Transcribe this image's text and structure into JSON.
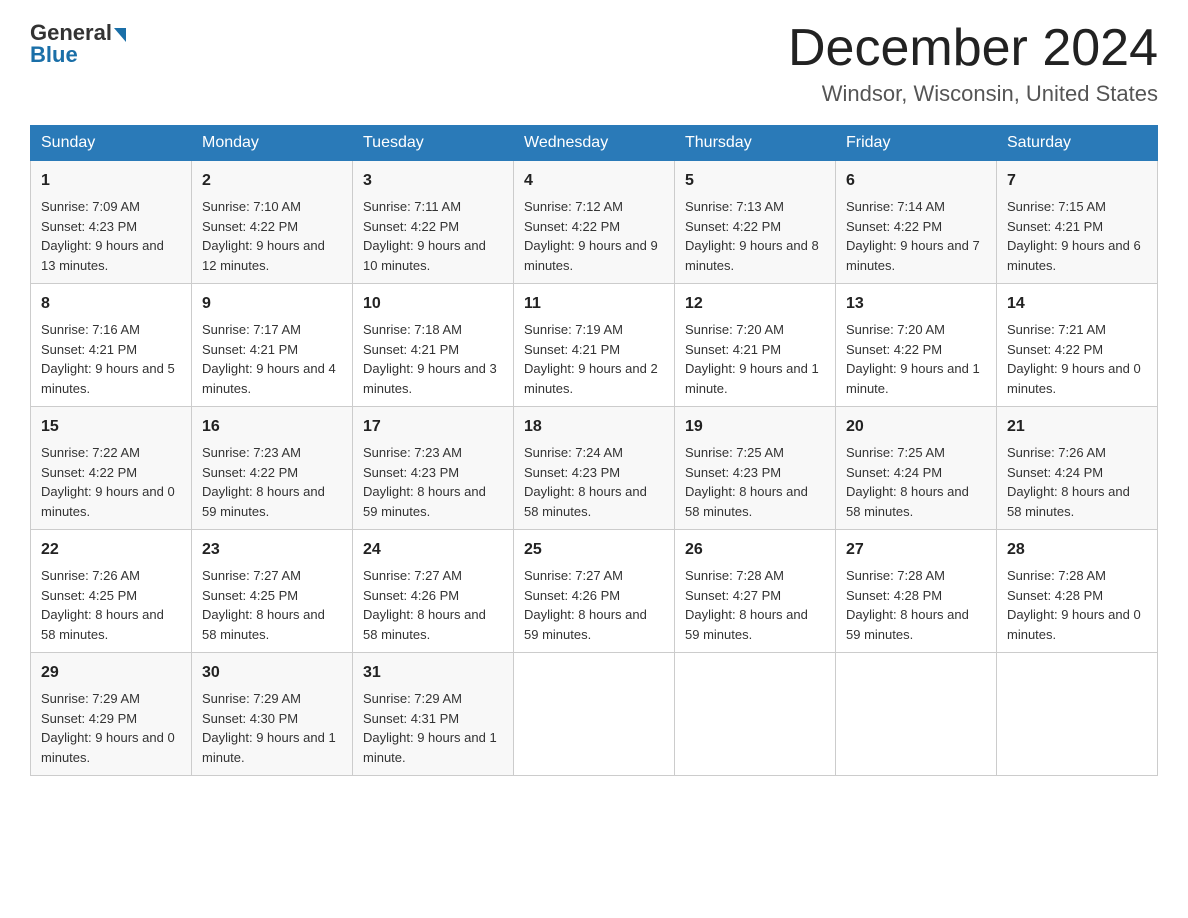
{
  "header": {
    "logo_general": "General",
    "logo_blue": "Blue",
    "month_title": "December 2024",
    "location": "Windsor, Wisconsin, United States"
  },
  "days_of_week": [
    "Sunday",
    "Monday",
    "Tuesday",
    "Wednesday",
    "Thursday",
    "Friday",
    "Saturday"
  ],
  "weeks": [
    [
      {
        "day": "1",
        "sunrise": "7:09 AM",
        "sunset": "4:23 PM",
        "daylight": "9 hours and 13 minutes."
      },
      {
        "day": "2",
        "sunrise": "7:10 AM",
        "sunset": "4:22 PM",
        "daylight": "9 hours and 12 minutes."
      },
      {
        "day": "3",
        "sunrise": "7:11 AM",
        "sunset": "4:22 PM",
        "daylight": "9 hours and 10 minutes."
      },
      {
        "day": "4",
        "sunrise": "7:12 AM",
        "sunset": "4:22 PM",
        "daylight": "9 hours and 9 minutes."
      },
      {
        "day": "5",
        "sunrise": "7:13 AM",
        "sunset": "4:22 PM",
        "daylight": "9 hours and 8 minutes."
      },
      {
        "day": "6",
        "sunrise": "7:14 AM",
        "sunset": "4:22 PM",
        "daylight": "9 hours and 7 minutes."
      },
      {
        "day": "7",
        "sunrise": "7:15 AM",
        "sunset": "4:21 PM",
        "daylight": "9 hours and 6 minutes."
      }
    ],
    [
      {
        "day": "8",
        "sunrise": "7:16 AM",
        "sunset": "4:21 PM",
        "daylight": "9 hours and 5 minutes."
      },
      {
        "day": "9",
        "sunrise": "7:17 AM",
        "sunset": "4:21 PM",
        "daylight": "9 hours and 4 minutes."
      },
      {
        "day": "10",
        "sunrise": "7:18 AM",
        "sunset": "4:21 PM",
        "daylight": "9 hours and 3 minutes."
      },
      {
        "day": "11",
        "sunrise": "7:19 AM",
        "sunset": "4:21 PM",
        "daylight": "9 hours and 2 minutes."
      },
      {
        "day": "12",
        "sunrise": "7:20 AM",
        "sunset": "4:21 PM",
        "daylight": "9 hours and 1 minute."
      },
      {
        "day": "13",
        "sunrise": "7:20 AM",
        "sunset": "4:22 PM",
        "daylight": "9 hours and 1 minute."
      },
      {
        "day": "14",
        "sunrise": "7:21 AM",
        "sunset": "4:22 PM",
        "daylight": "9 hours and 0 minutes."
      }
    ],
    [
      {
        "day": "15",
        "sunrise": "7:22 AM",
        "sunset": "4:22 PM",
        "daylight": "9 hours and 0 minutes."
      },
      {
        "day": "16",
        "sunrise": "7:23 AM",
        "sunset": "4:22 PM",
        "daylight": "8 hours and 59 minutes."
      },
      {
        "day": "17",
        "sunrise": "7:23 AM",
        "sunset": "4:23 PM",
        "daylight": "8 hours and 59 minutes."
      },
      {
        "day": "18",
        "sunrise": "7:24 AM",
        "sunset": "4:23 PM",
        "daylight": "8 hours and 58 minutes."
      },
      {
        "day": "19",
        "sunrise": "7:25 AM",
        "sunset": "4:23 PM",
        "daylight": "8 hours and 58 minutes."
      },
      {
        "day": "20",
        "sunrise": "7:25 AM",
        "sunset": "4:24 PM",
        "daylight": "8 hours and 58 minutes."
      },
      {
        "day": "21",
        "sunrise": "7:26 AM",
        "sunset": "4:24 PM",
        "daylight": "8 hours and 58 minutes."
      }
    ],
    [
      {
        "day": "22",
        "sunrise": "7:26 AM",
        "sunset": "4:25 PM",
        "daylight": "8 hours and 58 minutes."
      },
      {
        "day": "23",
        "sunrise": "7:27 AM",
        "sunset": "4:25 PM",
        "daylight": "8 hours and 58 minutes."
      },
      {
        "day": "24",
        "sunrise": "7:27 AM",
        "sunset": "4:26 PM",
        "daylight": "8 hours and 58 minutes."
      },
      {
        "day": "25",
        "sunrise": "7:27 AM",
        "sunset": "4:26 PM",
        "daylight": "8 hours and 59 minutes."
      },
      {
        "day": "26",
        "sunrise": "7:28 AM",
        "sunset": "4:27 PM",
        "daylight": "8 hours and 59 minutes."
      },
      {
        "day": "27",
        "sunrise": "7:28 AM",
        "sunset": "4:28 PM",
        "daylight": "8 hours and 59 minutes."
      },
      {
        "day": "28",
        "sunrise": "7:28 AM",
        "sunset": "4:28 PM",
        "daylight": "9 hours and 0 minutes."
      }
    ],
    [
      {
        "day": "29",
        "sunrise": "7:29 AM",
        "sunset": "4:29 PM",
        "daylight": "9 hours and 0 minutes."
      },
      {
        "day": "30",
        "sunrise": "7:29 AM",
        "sunset": "4:30 PM",
        "daylight": "9 hours and 1 minute."
      },
      {
        "day": "31",
        "sunrise": "7:29 AM",
        "sunset": "4:31 PM",
        "daylight": "9 hours and 1 minute."
      },
      null,
      null,
      null,
      null
    ]
  ]
}
